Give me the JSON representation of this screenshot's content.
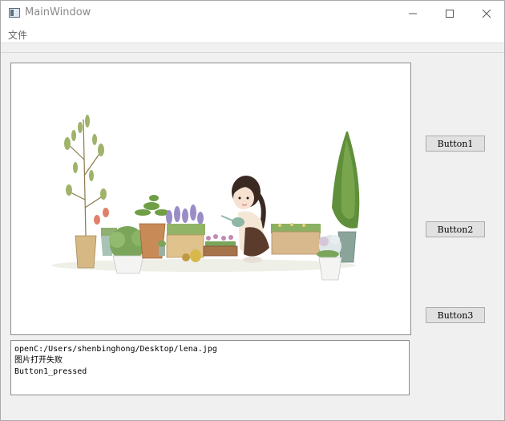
{
  "window": {
    "title": "MainWindow"
  },
  "menu": {
    "file_label": "文件"
  },
  "image_view": {
    "description_icon": "watercolor-garden-illustration"
  },
  "log": {
    "lines": [
      "openC:/Users/shenbinghong/Desktop/lena.jpg",
      "图片打开失败",
      "Button1_pressed"
    ]
  },
  "buttons": {
    "button1_label": "Button1",
    "button2_label": "Button2",
    "button3_label": "Button3"
  }
}
